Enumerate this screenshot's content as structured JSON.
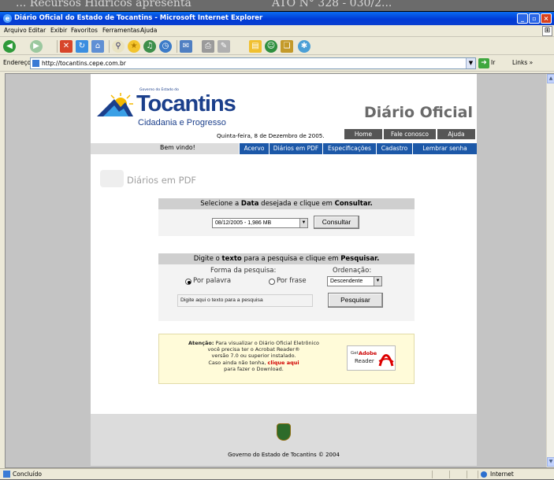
{
  "backdrop": {
    "line1": "...   Recursos Hídricos apresenta",
    "line2": "ATO N° 328 - 030/2..."
  },
  "window": {
    "title": "Diário Oficial do Estado de Tocantins - Microsoft Internet Explorer",
    "controls": [
      "_",
      "▫",
      "×"
    ]
  },
  "menubar": [
    "Arquivo",
    "Editar",
    "Exibir",
    "Favoritos",
    "Ferramentas",
    "Ajuda"
  ],
  "toolbar": {
    "icons": [
      "back-icon",
      "forward-icon",
      "stop-icon",
      "refresh-icon",
      "home-icon",
      "search-icon",
      "favorites-icon",
      "media-icon",
      "history-icon",
      "mail-icon",
      "print-icon",
      "edit-icon",
      "discuss-icon",
      "messenger-icon",
      "research-icon"
    ]
  },
  "address": {
    "label": "Endereço",
    "url": "http://tocantins.cepe.com.br",
    "go_label": "Ir",
    "links_label": "Links »"
  },
  "page": {
    "logo": {
      "small": "Governo do Estado do",
      "main": "Tocantins",
      "sub": "Cidadania e Progresso"
    },
    "diario_title": "Diário Oficial",
    "date": "Quinta-feira, 8 de Dezembro de 2005.",
    "top_nav": [
      "Home",
      "Fale conosco",
      "Ajuda"
    ],
    "welcome": "Bem vindo!",
    "main_nav": [
      "Acervo",
      "Diários em PDF",
      "Especificações",
      "Cadastro",
      "Lembrar senha"
    ],
    "section_title": "Diários em PDF",
    "panel_date": {
      "header_pre": "Selecione a ",
      "header_bold1": "Data",
      "header_mid": " desejada e clique em ",
      "header_bold2": "Consultar.",
      "selected": "08/12/2005 - 1,986 MB",
      "button": "Consultar"
    },
    "panel_search": {
      "header_pre": "Digite o ",
      "header_bold1": "texto",
      "header_mid": " para a pesquisa e clique em ",
      "header_bold2": "Pesquisar.",
      "mode_label": "Forma da pesquisa:",
      "order_label": "Ordenação:",
      "radio_word": "Por palavra",
      "radio_phrase": "Por frase",
      "order_selected": "Descendente",
      "input_value": "Digite aqui o texto para a pesquisa",
      "button": "Pesquisar"
    },
    "notice": {
      "bold": "Atenção:",
      "line1": " Para visualizar o Diário Oficial Eletrônico",
      "line2": "você precisa ter o Acrobat Reader®",
      "line3": "versão 7.0 ou superior instalado.",
      "line4_pre": "Caso ainda não tenha, ",
      "line4_link": "clique aqui",
      "line5": "para fazer o Download.",
      "adobe_get": "Get",
      "adobe_brand": "Adobe",
      "adobe_reader": "Reader"
    },
    "footer": "Governo do Estado de Tocantins © 2004"
  },
  "statusbar": {
    "left": "Concluído",
    "zone": "Internet"
  }
}
